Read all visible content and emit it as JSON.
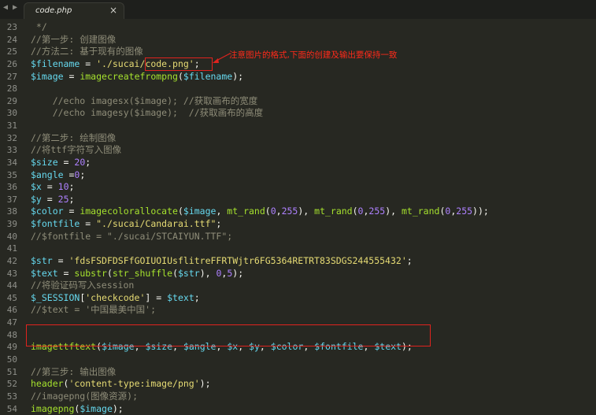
{
  "tabbar": {
    "nav_left": "◀",
    "nav_right": "▶",
    "tab_label": "code.php",
    "close_label": "×"
  },
  "annotation": {
    "text": "注意图片的格式,下面的创建及输出要保持一致",
    "color": "#e0231e"
  },
  "lines": [
    {
      "num": "23",
      "tokens": [
        {
          "t": " */",
          "k": "c"
        }
      ]
    },
    {
      "num": "24",
      "tokens": [
        {
          "t": "//第一步: 创建图像",
          "k": "c"
        }
      ]
    },
    {
      "num": "25",
      "tokens": [
        {
          "t": "//方法二: 基于现有的图像",
          "k": "c"
        }
      ]
    },
    {
      "num": "26",
      "tokens": [
        {
          "t": "$filename",
          "k": "v"
        },
        {
          "t": " = ",
          "k": "p"
        },
        {
          "t": "'./sucai/code.png'",
          "k": "s"
        },
        {
          "t": ";",
          "k": "p"
        }
      ]
    },
    {
      "num": "27",
      "tokens": [
        {
          "t": "$image",
          "k": "v"
        },
        {
          "t": " = ",
          "k": "p"
        },
        {
          "t": "imagecreatefrompng",
          "k": "f"
        },
        {
          "t": "(",
          "k": "p"
        },
        {
          "t": "$filename",
          "k": "v"
        },
        {
          "t": ");",
          "k": "p"
        }
      ]
    },
    {
      "num": "28",
      "tokens": []
    },
    {
      "num": "29",
      "tokens": [
        {
          "t": "    //echo imagesx($image); //获取画布的宽度",
          "k": "c"
        }
      ]
    },
    {
      "num": "30",
      "tokens": [
        {
          "t": "    //echo imagesy($image);  //获取画布的高度",
          "k": "c"
        }
      ]
    },
    {
      "num": "31",
      "tokens": []
    },
    {
      "num": "32",
      "tokens": [
        {
          "t": "//第二步: 绘制图像",
          "k": "c"
        }
      ]
    },
    {
      "num": "33",
      "tokens": [
        {
          "t": "//将ttf字符写入图像",
          "k": "c"
        }
      ]
    },
    {
      "num": "34",
      "tokens": [
        {
          "t": "$size",
          "k": "v"
        },
        {
          "t": " = ",
          "k": "p"
        },
        {
          "t": "20",
          "k": "n"
        },
        {
          "t": ";",
          "k": "p"
        }
      ]
    },
    {
      "num": "35",
      "tokens": [
        {
          "t": "$angle",
          "k": "v"
        },
        {
          "t": " =",
          "k": "p"
        },
        {
          "t": "0",
          "k": "n"
        },
        {
          "t": ";",
          "k": "p"
        }
      ]
    },
    {
      "num": "36",
      "tokens": [
        {
          "t": "$x",
          "k": "v"
        },
        {
          "t": " = ",
          "k": "p"
        },
        {
          "t": "10",
          "k": "n"
        },
        {
          "t": ";",
          "k": "p"
        }
      ]
    },
    {
      "num": "37",
      "tokens": [
        {
          "t": "$y",
          "k": "v"
        },
        {
          "t": " = ",
          "k": "p"
        },
        {
          "t": "25",
          "k": "n"
        },
        {
          "t": ";",
          "k": "p"
        }
      ]
    },
    {
      "num": "38",
      "tokens": [
        {
          "t": "$color",
          "k": "v"
        },
        {
          "t": " = ",
          "k": "p"
        },
        {
          "t": "imagecolorallocate",
          "k": "f"
        },
        {
          "t": "(",
          "k": "p"
        },
        {
          "t": "$image",
          "k": "v"
        },
        {
          "t": ", ",
          "k": "p"
        },
        {
          "t": "mt_rand",
          "k": "f"
        },
        {
          "t": "(",
          "k": "p"
        },
        {
          "t": "0",
          "k": "n"
        },
        {
          "t": ",",
          "k": "p"
        },
        {
          "t": "255",
          "k": "n"
        },
        {
          "t": "), ",
          "k": "p"
        },
        {
          "t": "mt_rand",
          "k": "f"
        },
        {
          "t": "(",
          "k": "p"
        },
        {
          "t": "0",
          "k": "n"
        },
        {
          "t": ",",
          "k": "p"
        },
        {
          "t": "255",
          "k": "n"
        },
        {
          "t": "), ",
          "k": "p"
        },
        {
          "t": "mt_rand",
          "k": "f"
        },
        {
          "t": "(",
          "k": "p"
        },
        {
          "t": "0",
          "k": "n"
        },
        {
          "t": ",",
          "k": "p"
        },
        {
          "t": "255",
          "k": "n"
        },
        {
          "t": "));",
          "k": "p"
        }
      ]
    },
    {
      "num": "39",
      "tokens": [
        {
          "t": "$fontfile",
          "k": "v"
        },
        {
          "t": " = ",
          "k": "p"
        },
        {
          "t": "\"./sucai/Candarai.ttf\"",
          "k": "s"
        },
        {
          "t": ";",
          "k": "p"
        }
      ]
    },
    {
      "num": "40",
      "tokens": [
        {
          "t": "//$fontfile = \"./sucai/STCAIYUN.TTF\";",
          "k": "c"
        }
      ]
    },
    {
      "num": "41",
      "tokens": []
    },
    {
      "num": "42",
      "tokens": [
        {
          "t": "$str",
          "k": "v"
        },
        {
          "t": " = ",
          "k": "p"
        },
        {
          "t": "'fdsFSDFDSFfGOIUOIUsflitreFFRTWjtr6FG5364RETRT83SDGS244555432'",
          "k": "s"
        },
        {
          "t": ";",
          "k": "p"
        }
      ]
    },
    {
      "num": "43",
      "tokens": [
        {
          "t": "$text",
          "k": "v"
        },
        {
          "t": " = ",
          "k": "p"
        },
        {
          "t": "substr",
          "k": "f"
        },
        {
          "t": "(",
          "k": "p"
        },
        {
          "t": "str_shuffle",
          "k": "f"
        },
        {
          "t": "(",
          "k": "p"
        },
        {
          "t": "$str",
          "k": "v"
        },
        {
          "t": "), ",
          "k": "p"
        },
        {
          "t": "0",
          "k": "n"
        },
        {
          "t": ",",
          "k": "p"
        },
        {
          "t": "5",
          "k": "n"
        },
        {
          "t": ");",
          "k": "p"
        }
      ]
    },
    {
      "num": "44",
      "tokens": [
        {
          "t": "//将验证码写入session",
          "k": "c"
        }
      ]
    },
    {
      "num": "45",
      "tokens": [
        {
          "t": "$_SESSION",
          "k": "v"
        },
        {
          "t": "[",
          "k": "p"
        },
        {
          "t": "'checkcode'",
          "k": "s"
        },
        {
          "t": "] = ",
          "k": "p"
        },
        {
          "t": "$text",
          "k": "v"
        },
        {
          "t": ";",
          "k": "p"
        }
      ]
    },
    {
      "num": "46",
      "tokens": [
        {
          "t": "//$text = '中国最美中国';",
          "k": "c"
        }
      ]
    },
    {
      "num": "47",
      "tokens": []
    },
    {
      "num": "48",
      "tokens": []
    },
    {
      "num": "49",
      "tokens": [
        {
          "t": "imagettftext",
          "k": "f"
        },
        {
          "t": "(",
          "k": "p"
        },
        {
          "t": "$image",
          "k": "v"
        },
        {
          "t": ", ",
          "k": "p"
        },
        {
          "t": "$size",
          "k": "v"
        },
        {
          "t": ", ",
          "k": "p"
        },
        {
          "t": "$angle",
          "k": "v"
        },
        {
          "t": ", ",
          "k": "p"
        },
        {
          "t": "$x",
          "k": "v"
        },
        {
          "t": ", ",
          "k": "p"
        },
        {
          "t": "$y",
          "k": "v"
        },
        {
          "t": ", ",
          "k": "p"
        },
        {
          "t": "$color",
          "k": "v"
        },
        {
          "t": ", ",
          "k": "p"
        },
        {
          "t": "$fontfile",
          "k": "v"
        },
        {
          "t": ", ",
          "k": "p"
        },
        {
          "t": "$text",
          "k": "v"
        },
        {
          "t": ");",
          "k": "p"
        }
      ]
    },
    {
      "num": "50",
      "tokens": []
    },
    {
      "num": "51",
      "tokens": [
        {
          "t": "//第三步: 输出图像",
          "k": "c"
        }
      ]
    },
    {
      "num": "52",
      "tokens": [
        {
          "t": "header",
          "k": "f"
        },
        {
          "t": "(",
          "k": "p"
        },
        {
          "t": "'content-type:image/png'",
          "k": "s"
        },
        {
          "t": ");",
          "k": "p"
        }
      ]
    },
    {
      "num": "53",
      "tokens": [
        {
          "t": "//imagepng(图像资源);",
          "k": "c"
        }
      ]
    },
    {
      "num": "54",
      "tokens": [
        {
          "t": "imagepng",
          "k": "f"
        },
        {
          "t": "(",
          "k": "p"
        },
        {
          "t": "$image",
          "k": "v"
        },
        {
          "t": ");",
          "k": "p"
        }
      ]
    }
  ]
}
